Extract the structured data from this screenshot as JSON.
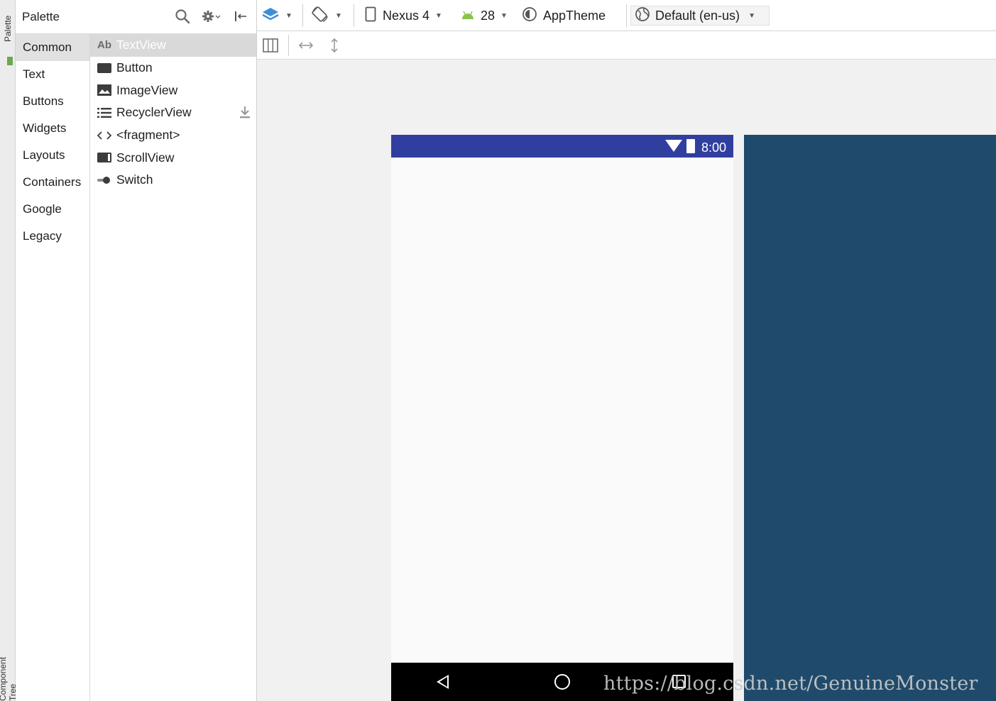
{
  "left_strip": {
    "top_label": "Palette",
    "bottom_label": "Component Tree"
  },
  "palette": {
    "title": "Palette",
    "categories": [
      "Common",
      "Text",
      "Buttons",
      "Widgets",
      "Layouts",
      "Containers",
      "Google",
      "Legacy"
    ],
    "selected_category": "Common",
    "components": [
      {
        "label": "TextView",
        "icon": "Ab",
        "selected": true
      },
      {
        "label": "Button",
        "icon": "button-icon"
      },
      {
        "label": "ImageView",
        "icon": "image-icon"
      },
      {
        "label": "RecyclerView",
        "icon": "list-icon",
        "download": true
      },
      {
        "label": "<fragment>",
        "icon": "code-icon"
      },
      {
        "label": "ScrollView",
        "icon": "scrollview-icon"
      },
      {
        "label": "Switch",
        "icon": "switch-icon"
      }
    ]
  },
  "toolbar": {
    "device": "Nexus 4",
    "api_level": "28",
    "theme": "AppTheme",
    "locale": "Default (en-us)"
  },
  "preview": {
    "status_time": "8:00",
    "status_bar_color": "#303f9f",
    "blueprint_color": "#1f4a6b"
  },
  "watermark": "https://blog.csdn.net/GenuineMonster"
}
